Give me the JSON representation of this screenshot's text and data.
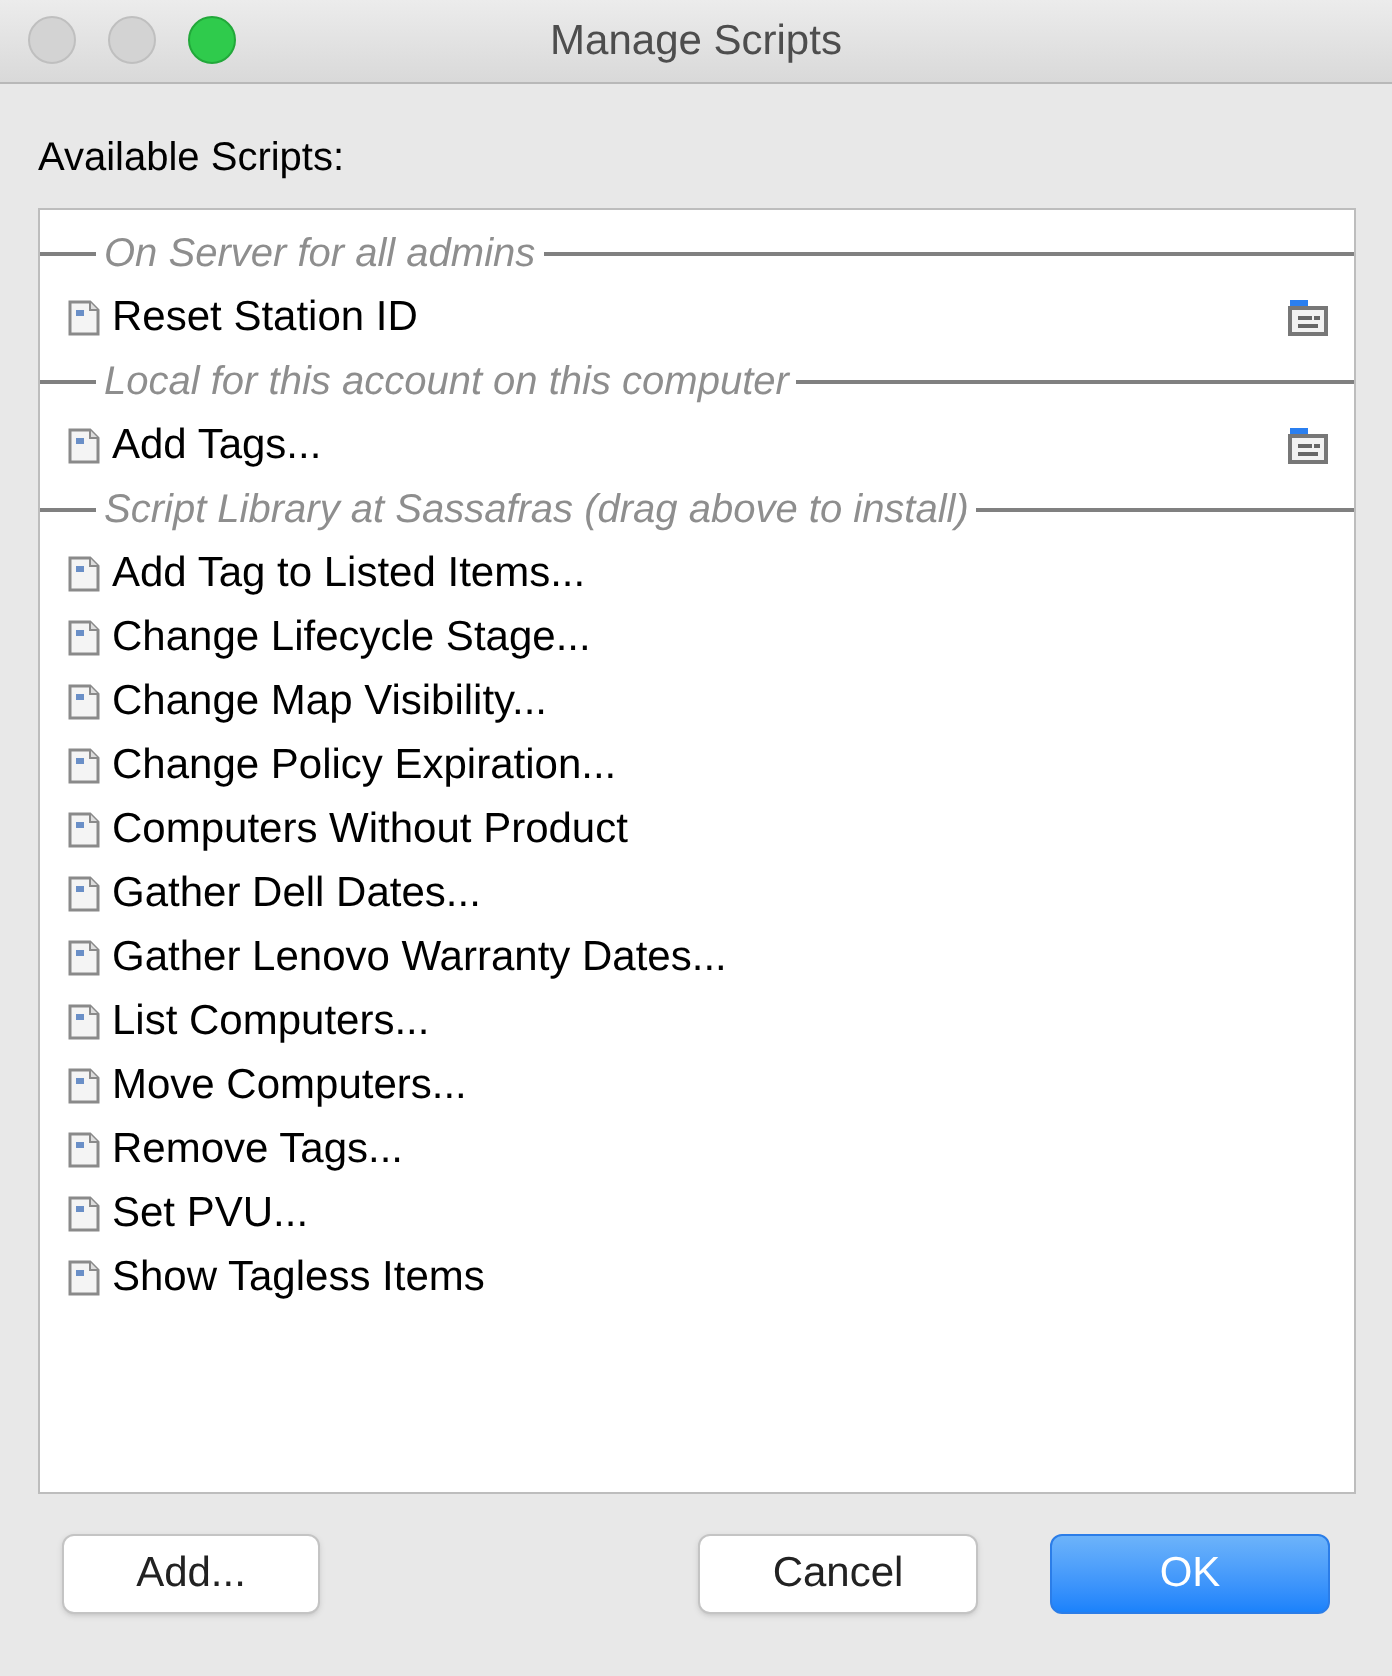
{
  "window": {
    "title": "Manage Scripts",
    "traffic_lights": [
      {
        "kind": "close",
        "enabled": false
      },
      {
        "kind": "minimize",
        "enabled": false
      },
      {
        "kind": "zoom",
        "enabled": true
      }
    ]
  },
  "label": "Available Scripts:",
  "sections": [
    {
      "heading": "On Server for all admins",
      "items": [
        {
          "name": "Reset Station ID",
          "folder_icon": true
        }
      ]
    },
    {
      "heading": "Local for this account on this computer",
      "items": [
        {
          "name": "Add Tags...",
          "folder_icon": true
        }
      ]
    },
    {
      "heading": "Script Library at Sassafras (drag above to install)",
      "items": [
        {
          "name": "Add Tag to Listed Items...",
          "folder_icon": false
        },
        {
          "name": "Change Lifecycle Stage...",
          "folder_icon": false
        },
        {
          "name": "Change Map Visibility...",
          "folder_icon": false
        },
        {
          "name": "Change Policy Expiration...",
          "folder_icon": false
        },
        {
          "name": "Computers Without Product",
          "folder_icon": false
        },
        {
          "name": "Gather Dell Dates...",
          "folder_icon": false
        },
        {
          "name": "Gather Lenovo Warranty Dates...",
          "folder_icon": false
        },
        {
          "name": "List Computers...",
          "folder_icon": false
        },
        {
          "name": "Move Computers...",
          "folder_icon": false
        },
        {
          "name": "Remove Tags...",
          "folder_icon": false
        },
        {
          "name": "Set PVU...",
          "folder_icon": false
        },
        {
          "name": "Show Tagless Items",
          "folder_icon": false
        }
      ]
    }
  ],
  "buttons": [
    {
      "label": "Add...",
      "kind": "normal"
    },
    {
      "label": "Cancel",
      "kind": "normal"
    },
    {
      "label": "OK",
      "kind": "default"
    }
  ]
}
